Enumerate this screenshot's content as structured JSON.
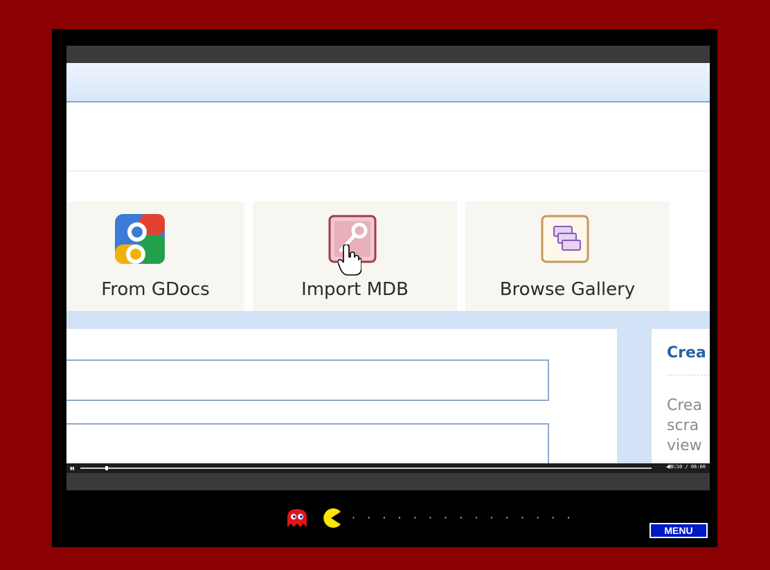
{
  "tiles": [
    {
      "label": "From GDocs",
      "icon": "google-icon"
    },
    {
      "label": "Import MDB",
      "icon": "key-icon"
    },
    {
      "label": "Browse Gallery",
      "icon": "gallery-icon"
    }
  ],
  "side_panel": {
    "title": "Crea",
    "lines": [
      "Crea",
      "scra",
      "view"
    ]
  },
  "player": {
    "time": "00:10 / 06:00",
    "menu_label": "MENU",
    "dots": "· · · · · · · · · · · · · ·    ·"
  },
  "colors": {
    "frame": "#8b0000",
    "menu": "#0019c7",
    "ghost": "#e0141a",
    "pacman": "#ffe500"
  }
}
